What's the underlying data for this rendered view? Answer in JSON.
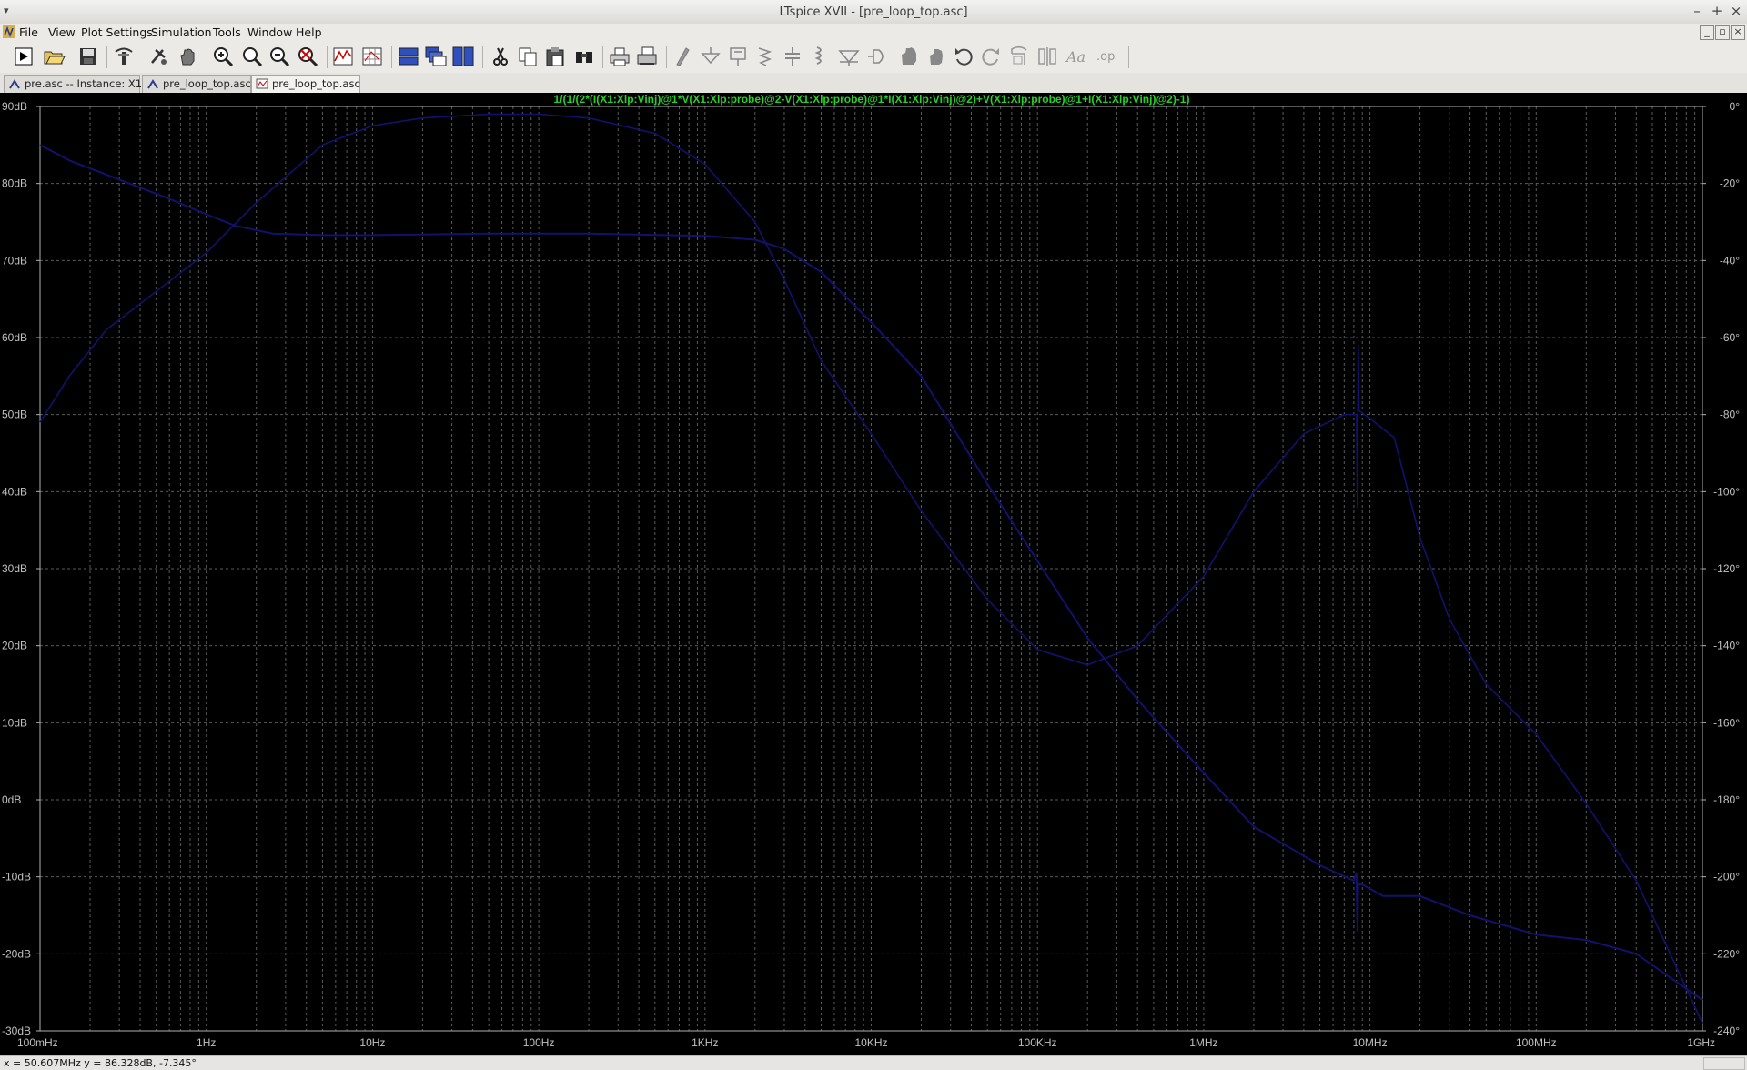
{
  "window": {
    "title": "LTspice XVII - [pre_loop_top.asc]",
    "sysmenu": "▾",
    "buttons": [
      "–",
      "+",
      "×"
    ]
  },
  "menu": {
    "items": [
      "File",
      "View",
      "Plot Settings",
      "Simulation",
      "Tools",
      "Window",
      "Help"
    ],
    "mdi_buttons": [
      "_",
      "▫",
      "×"
    ]
  },
  "toolbar": {
    "buttons": [
      "run",
      "open",
      "save",
      "control-panel",
      "halt",
      "pan",
      "zoom-in",
      "zoom-box",
      "zoom-out",
      "zoom-full",
      "autoscale",
      "grid",
      "tile-horizontal",
      "cascade",
      "tile-vertical",
      "cut",
      "copy",
      "paste",
      "find",
      "print",
      "print-preview",
      "draw-wire",
      "ground",
      "label-net",
      "resistor",
      "capacitor",
      "inductor",
      "diode",
      "component",
      "move",
      "drag",
      "undo",
      "redo",
      "rotate",
      "mirror",
      "text",
      "spice-directive"
    ]
  },
  "tabs": [
    {
      "label": "pre.asc -- Instance: X1",
      "icon": "schematic-icon",
      "active": false
    },
    {
      "label": "pre_loop_top.asc",
      "icon": "schematic-icon",
      "active": false
    },
    {
      "label": "pre_loop_top.asc",
      "icon": "waveform-icon",
      "active": true
    }
  ],
  "status": {
    "coords": "x = 50.607MHz    y = 86.328dB, -7.345°"
  },
  "colors": {
    "trace": "#12126e",
    "title_trace": "#28d028",
    "grid": "#5a5a5a",
    "axis_text": "#c0c0c0",
    "background": "#000000"
  },
  "chart_data": {
    "type": "line",
    "title": "1/(1/(2*(I(X1:Xlp:Vinj)@1*V(X1:Xlp:probe)@2-V(X1:Xlp:probe)@1*I(X1:Xlp:Vinj)@2)+V(X1:Xlp:probe)@1+I(X1:Xlp:Vinj)@2)-1)",
    "x_scale": "log",
    "xlim_hz": [
      0.1,
      1000000000
    ],
    "ylim_db": [
      -30,
      90
    ],
    "ylim_phase_deg": [
      -240,
      0
    ],
    "grid": true,
    "x_tick_labels": [
      "100mHz",
      "1Hz",
      "10Hz",
      "100Hz",
      "1KHz",
      "10KHz",
      "100KHz",
      "1MHz",
      "10MHz",
      "100MHz",
      "1GHz"
    ],
    "y_tick_labels": [
      "90dB",
      "80dB",
      "70dB",
      "60dB",
      "50dB",
      "40dB",
      "30dB",
      "20dB",
      "10dB",
      "0dB",
      "-10dB",
      "-20dB",
      "-30dB"
    ],
    "y2_tick_labels": [
      "0°",
      "-20°",
      "-40°",
      "-60°",
      "-80°",
      "-100°",
      "-120°",
      "-140°",
      "-160°",
      "-180°",
      "-200°",
      "-220°",
      "-240°"
    ],
    "series": [
      {
        "axis": "magnitude_db",
        "x": [
          0.1,
          0.15,
          0.3,
          0.6,
          1.0,
          1.5,
          2.5,
          5,
          10,
          50,
          200,
          1000,
          2000,
          3000,
          5000,
          10000,
          20000,
          50000,
          100000,
          200000,
          400000,
          1000000,
          2000000,
          5000000,
          8000000,
          8300000,
          8400000,
          8500000,
          9000000,
          12000000,
          20000000,
          40000000,
          100000000,
          200000000,
          400000000,
          1000000000
        ],
        "values": [
          85,
          83,
          80.5,
          78,
          76,
          74.5,
          73.5,
          73.3,
          73.3,
          73.5,
          73.5,
          73.2,
          72.7,
          71.5,
          68.5,
          62,
          55,
          41,
          31,
          21,
          13,
          3.5,
          -3.5,
          -8.5,
          -10.5,
          -9.5,
          -17,
          -11,
          -11,
          -12.5,
          -12.5,
          -15,
          -17.5,
          -18.2,
          -20,
          -26
        ]
      },
      {
        "axis": "phase_deg",
        "x": [
          0.1,
          0.15,
          0.25,
          0.5,
          1,
          2,
          5,
          10,
          20,
          50,
          100,
          200,
          500,
          1000,
          2000,
          3000,
          5000,
          10000,
          20000,
          50000,
          100000,
          200000,
          400000,
          1000000,
          2000000,
          4000000,
          7000000,
          8300000,
          8400000,
          8500000,
          8600000,
          10000000,
          14000000,
          20000000,
          30000000,
          50000000,
          100000000,
          200000000,
          400000000,
          1000000000
        ],
        "values": [
          -82,
          -70,
          -58,
          -48,
          -38,
          -25,
          -10,
          -5,
          -3,
          -2,
          -2,
          -3,
          -7,
          -15,
          -30,
          -45,
          -66,
          -85,
          -105,
          -128,
          -141,
          -145,
          -140,
          -122,
          -100,
          -85,
          -80,
          -80,
          -104,
          -62,
          -79,
          -81,
          -86,
          -112,
          -133,
          -150,
          -163,
          -181,
          -201,
          -238
        ]
      }
    ]
  }
}
